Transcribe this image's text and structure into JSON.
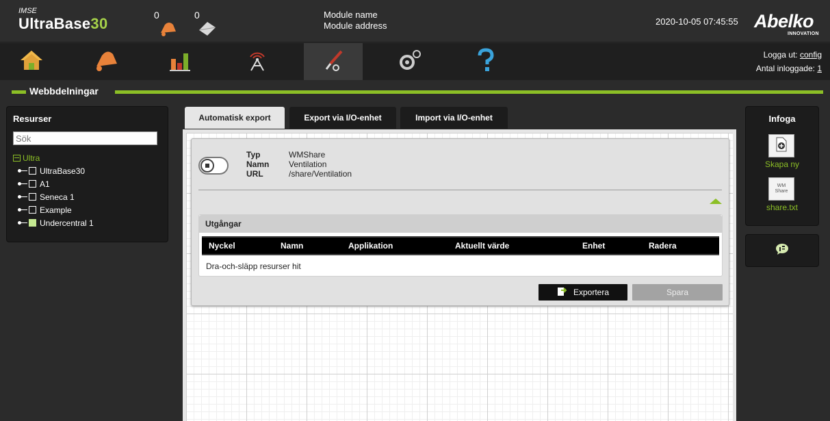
{
  "header": {
    "brand_small": "IMSE",
    "brand_name": "UltraBase",
    "brand_number": "30",
    "alarm_count": "0",
    "message_count": "0",
    "module_name": "Module name",
    "module_address": "Module address",
    "datetime": "2020-10-05 07:45:55",
    "logo_text": "Abelko",
    "logo_sub": "INNOVATION"
  },
  "nav": {
    "items": [
      {
        "icon": "home-icon"
      },
      {
        "icon": "bell-icon"
      },
      {
        "icon": "chart-icon"
      },
      {
        "icon": "antenna-icon"
      },
      {
        "icon": "tools-icon",
        "active": true
      },
      {
        "icon": "gears-icon"
      },
      {
        "icon": "help-icon"
      }
    ],
    "logout_label": "Logga ut:",
    "logout_user": "config",
    "logged_in_label": "Antal inloggade:",
    "logged_in_count": "1"
  },
  "section": {
    "title": "Webbdelningar"
  },
  "resources": {
    "title": "Resurser",
    "search_placeholder": "Sök",
    "root": "Ultra",
    "items": [
      {
        "label": "UltraBase30",
        "checked": false
      },
      {
        "label": "A1",
        "checked": false
      },
      {
        "label": "Seneca 1",
        "checked": false
      },
      {
        "label": "Example",
        "checked": false
      },
      {
        "label": "Undercentral 1",
        "checked": true
      }
    ]
  },
  "tabs": [
    {
      "label": "Automatisk export",
      "active": true
    },
    {
      "label": "Export via I/O-enhet",
      "active": false
    },
    {
      "label": "Import via I/O-enhet",
      "active": false
    }
  ],
  "share": {
    "type_label": "Typ",
    "name_label": "Namn",
    "url_label": "URL",
    "type_value": "WMShare",
    "name_value": "Ventilation",
    "url_value": "/share/Ventilation"
  },
  "outputs": {
    "title": "Utgångar",
    "columns": [
      "Nyckel",
      "Namn",
      "Applikation",
      "Aktuellt värde",
      "Enhet",
      "Radera"
    ],
    "drop_hint": "Dra-och-släpp resurser hit"
  },
  "buttons": {
    "export_label": "Exportera",
    "save_label": "Spara"
  },
  "insert": {
    "title": "Infoga",
    "create_new_label": "Skapa ny",
    "wm_line1": "WM",
    "wm_line2": "Share",
    "file_label": "share.txt"
  },
  "colors": {
    "accent": "#8cbf26",
    "header_bg": "#2d2d2d",
    "panel_bg": "#1c1c1c"
  }
}
